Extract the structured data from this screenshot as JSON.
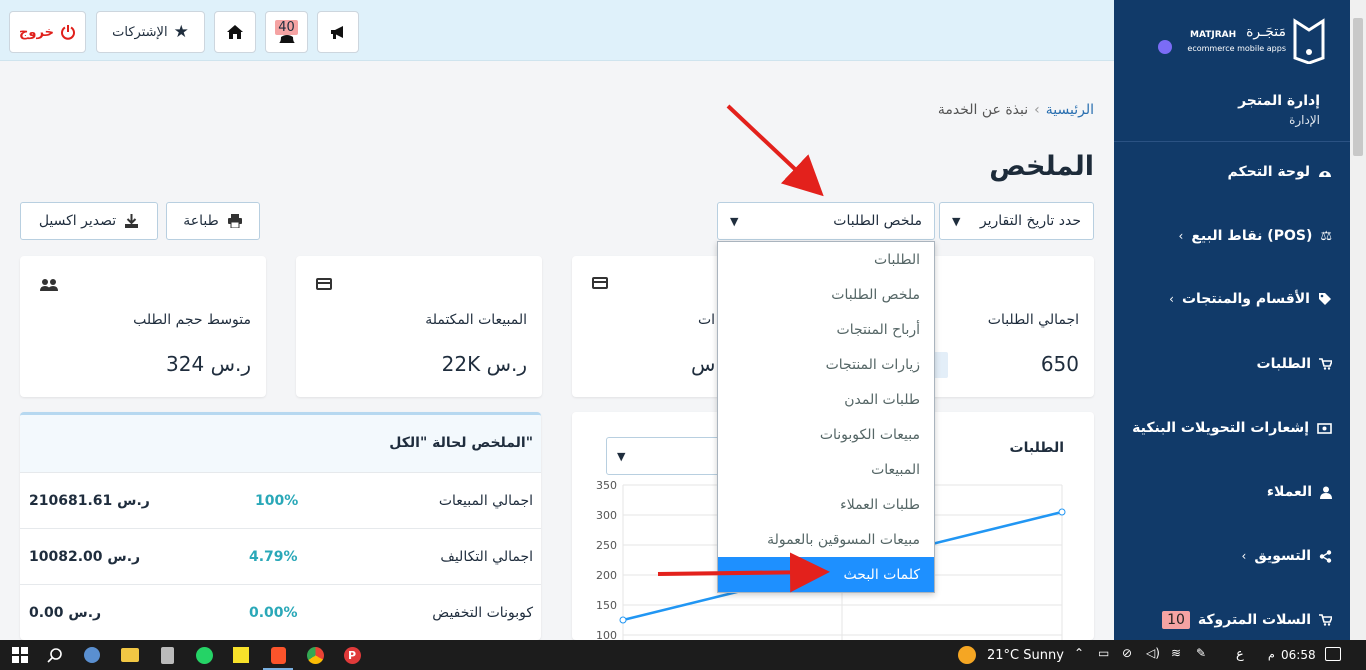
{
  "topbar": {
    "logout": "خروج",
    "subscriptions": "الإشتركات",
    "notif_count": "40"
  },
  "sidebar": {
    "brand_en": "MATJRAH",
    "brand_ar": "مَتجَـرة",
    "brand_tag": "ecommerce mobile apps",
    "store_title": "إدارة المتجر",
    "store_sub": "الإدارة",
    "items": [
      {
        "label": "لوحة التحكم",
        "icon": "dashboard-icon"
      },
      {
        "label": "نقاط البيع (POS)",
        "icon": "scale-icon"
      },
      {
        "label": "الأقسام والمنتجات",
        "icon": "tag-icon"
      },
      {
        "label": "الطلبات",
        "icon": "cart-icon"
      },
      {
        "label": "إشعارات التحويلات البنكية",
        "icon": "money-icon"
      },
      {
        "label": "العملاء",
        "icon": "user-icon"
      },
      {
        "label": "التسويق",
        "icon": "share-icon"
      },
      {
        "label": "السلات المتروكة",
        "icon": "cart-icon",
        "badge": "10"
      }
    ]
  },
  "breadcrumb": {
    "home": "الرئيسية",
    "sep": "›",
    "current": "نبذة عن الخدمة"
  },
  "page_title": "الملخص",
  "controls": {
    "date_select": "حدد تاريخ التقارير",
    "report_select": "ملخص الطلبات",
    "print": "طباعة",
    "export": "تصدير اكسيل"
  },
  "dropdown": {
    "options": [
      "الطلبات",
      "ملخص الطلبات",
      "أرباح المنتجات",
      "زيارات المنتجات",
      "طلبات المدن",
      "مبيعات الكوبونات",
      "المبيعات",
      "طلبات العملاء",
      "مبيعات المسوقين بالعمولة",
      "كلمات البحث"
    ],
    "selected_index": 9
  },
  "stats": [
    {
      "label": "اجمالي الطلبات",
      "value": "650"
    },
    {
      "label": "ات",
      "value": "س"
    },
    {
      "label": "المبيعات المكتملة",
      "value": "22K ر.س"
    },
    {
      "label": "متوسط حجم الطلب",
      "value": "324 ر.س"
    }
  ],
  "summary": {
    "title": "الملخص لحالة \"الكل\"",
    "rows": [
      {
        "label": "اجمالي المبيعات",
        "pct": "100%",
        "value": "210681.61 ر.س"
      },
      {
        "label": "اجمالي التكاليف",
        "pct": "4.79%",
        "value": "10082.00 ر.س"
      },
      {
        "label": "كوبونات التخفيض",
        "pct": "0.00%",
        "value": "0.00 ر.س"
      }
    ]
  },
  "orders_chart_title": "الطلبات",
  "chart_data": {
    "type": "line",
    "title": "الطلبات",
    "yticks": [
      100,
      150,
      200,
      250,
      300,
      350
    ],
    "ylim": [
      100,
      350
    ],
    "series": [
      {
        "values": [
          125,
          305
        ]
      }
    ],
    "line_color": "#2196f3"
  },
  "taskbar": {
    "weather": "21°C Sunny",
    "time": "06:58",
    "ampm": "م",
    "lang": "ع"
  }
}
